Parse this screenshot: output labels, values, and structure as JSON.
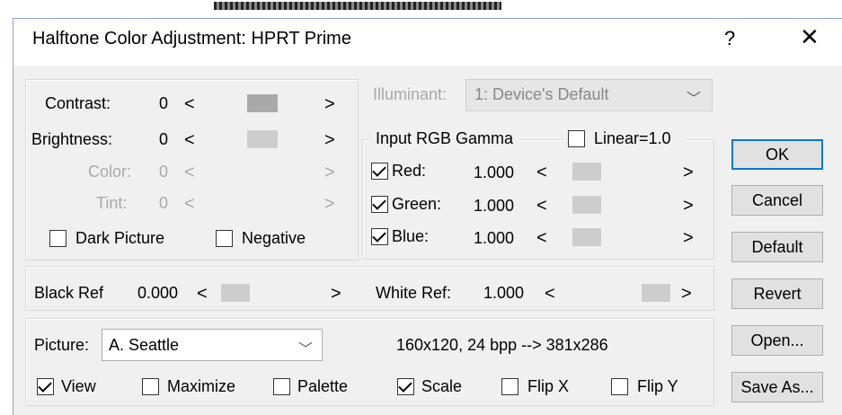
{
  "window": {
    "title": "Halftone Color Adjustment: HPRT Prime",
    "help_label": "?",
    "close_label": "✕"
  },
  "adjust": {
    "contrast": {
      "label": "Contrast:",
      "value": "0"
    },
    "brightness": {
      "label": "Brightness:",
      "value": "0"
    },
    "color": {
      "label": "Color:",
      "value": "0"
    },
    "tint": {
      "label": "Tint:",
      "value": "0"
    },
    "dark_picture": {
      "label": "Dark Picture",
      "checked": false
    },
    "negative": {
      "label": "Negative",
      "checked": false
    }
  },
  "illuminant": {
    "label": "Illuminant:",
    "value": "1: Device's Default"
  },
  "gamma": {
    "group_label": "Input RGB Gamma",
    "linear": {
      "label": "Linear=1.0",
      "checked": false
    },
    "red": {
      "label": "Red:",
      "value": "1.000",
      "checked": true
    },
    "green": {
      "label": "Green:",
      "value": "1.000",
      "checked": true
    },
    "blue": {
      "label": "Blue:",
      "value": "1.000",
      "checked": true
    }
  },
  "refs": {
    "black": {
      "label": "Black Ref",
      "value": "0.000"
    },
    "white": {
      "label": "White Ref:",
      "value": "1.000"
    }
  },
  "picture": {
    "label": "Picture:",
    "value": "A. Seattle",
    "info": "160x120, 24 bpp  --> 381x286",
    "view": {
      "label": "View",
      "checked": true
    },
    "maximize": {
      "label": "Maximize",
      "checked": false
    },
    "palette": {
      "label": "Palette",
      "checked": false
    },
    "scale": {
      "label": "Scale",
      "checked": true
    },
    "flipx": {
      "label": "Flip X",
      "checked": false
    },
    "flipy": {
      "label": "Flip Y",
      "checked": false
    }
  },
  "buttons": {
    "ok": "OK",
    "cancel": "Cancel",
    "default": "Default",
    "revert": "Revert",
    "open": "Open...",
    "saveas": "Save As..."
  },
  "glyphs": {
    "left": "<",
    "right": ">",
    "chevron": "﹀"
  },
  "colors": {
    "accent": "#0078d7",
    "disabled_text": "#a8a8a8",
    "dialog_bg": "#f0f0f0"
  }
}
